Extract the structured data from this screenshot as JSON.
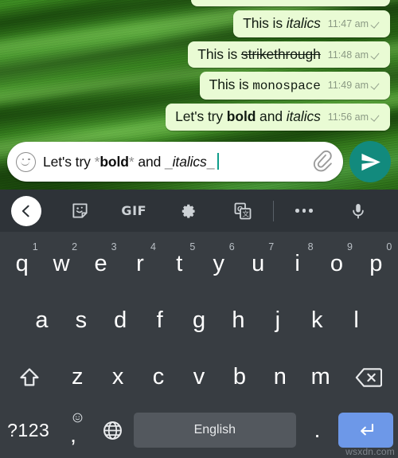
{
  "chat": {
    "messages": [
      {
        "id": "msg-partial",
        "parts": [
          {
            "text": "",
            "style": "plain"
          }
        ],
        "time": "",
        "status_icon": "single-check-icon",
        "partial": true
      },
      {
        "id": "msg-italics",
        "parts": [
          {
            "text": "This is ",
            "style": "plain"
          },
          {
            "text": "italics",
            "style": "italic"
          }
        ],
        "time": "11:47 am",
        "status_icon": "single-check-icon"
      },
      {
        "id": "msg-strikethrough",
        "parts": [
          {
            "text": "This is ",
            "style": "plain"
          },
          {
            "text": "strikethrough",
            "style": "strike"
          }
        ],
        "time": "11:48 am",
        "status_icon": "single-check-icon"
      },
      {
        "id": "msg-monospace",
        "parts": [
          {
            "text": "This is ",
            "style": "plain"
          },
          {
            "text": "monospace",
            "style": "mono"
          }
        ],
        "time": "11:49 am",
        "status_icon": "single-check-icon"
      },
      {
        "id": "msg-bold-italics",
        "parts": [
          {
            "text": "Let's try ",
            "style": "plain"
          },
          {
            "text": "bold",
            "style": "bold"
          },
          {
            "text": " and ",
            "style": "plain"
          },
          {
            "text": "italics",
            "style": "italic"
          }
        ],
        "time": "11:56 am",
        "status_icon": "single-check-icon"
      }
    ]
  },
  "composer": {
    "emoji_icon": "smiley-icon",
    "value_segments": [
      {
        "text": "Let's try ",
        "kind": "plain"
      },
      {
        "text": "*",
        "kind": "marker"
      },
      {
        "text": "bold",
        "kind": "bold"
      },
      {
        "text": "*",
        "kind": "marker"
      },
      {
        "text": " and ",
        "kind": "plain"
      },
      {
        "text": "_",
        "kind": "marker"
      },
      {
        "text": "italics",
        "kind": "italic"
      },
      {
        "text": "_",
        "kind": "marker"
      }
    ],
    "value_plain": "Let's try *bold* and _italics_",
    "attach_icon": "paperclip-icon",
    "send_icon": "send-icon",
    "send_color": "#128a7d",
    "caret_color": "#0f9d8a"
  },
  "keyboard": {
    "toolbar": {
      "back_icon": "chevron-left-icon",
      "items": [
        {
          "name": "sticker-icon",
          "label": ""
        },
        {
          "name": "gif-button",
          "label": "GIF"
        },
        {
          "name": "gear-icon",
          "label": ""
        },
        {
          "name": "translate-icon",
          "label": ""
        },
        {
          "name": "overflow-menu-icon",
          "label": ""
        },
        {
          "name": "microphone-icon",
          "label": ""
        }
      ]
    },
    "row1": [
      {
        "key": "q",
        "sup": "1"
      },
      {
        "key": "w",
        "sup": "2"
      },
      {
        "key": "e",
        "sup": "3"
      },
      {
        "key": "r",
        "sup": "4"
      },
      {
        "key": "t",
        "sup": "5"
      },
      {
        "key": "y",
        "sup": "6"
      },
      {
        "key": "u",
        "sup": "7"
      },
      {
        "key": "i",
        "sup": "8"
      },
      {
        "key": "o",
        "sup": "9"
      },
      {
        "key": "p",
        "sup": "0"
      }
    ],
    "row2": [
      "a",
      "s",
      "d",
      "f",
      "g",
      "h",
      "j",
      "k",
      "l"
    ],
    "row3": {
      "shift_icon": "shift-icon",
      "keys": [
        "z",
        "x",
        "c",
        "v",
        "b",
        "n",
        "m"
      ],
      "backspace_icon": "backspace-icon"
    },
    "row4": {
      "symbols_label": "?123",
      "comma_label": ",",
      "comma_sup_icon": "emoji-icon",
      "globe_icon": "globe-icon",
      "space_label": "English",
      "period_label": ".",
      "enter_icon": "enter-icon",
      "enter_color": "#6d98e8"
    }
  },
  "watermark": {
    "text": "wsxdn.com"
  }
}
